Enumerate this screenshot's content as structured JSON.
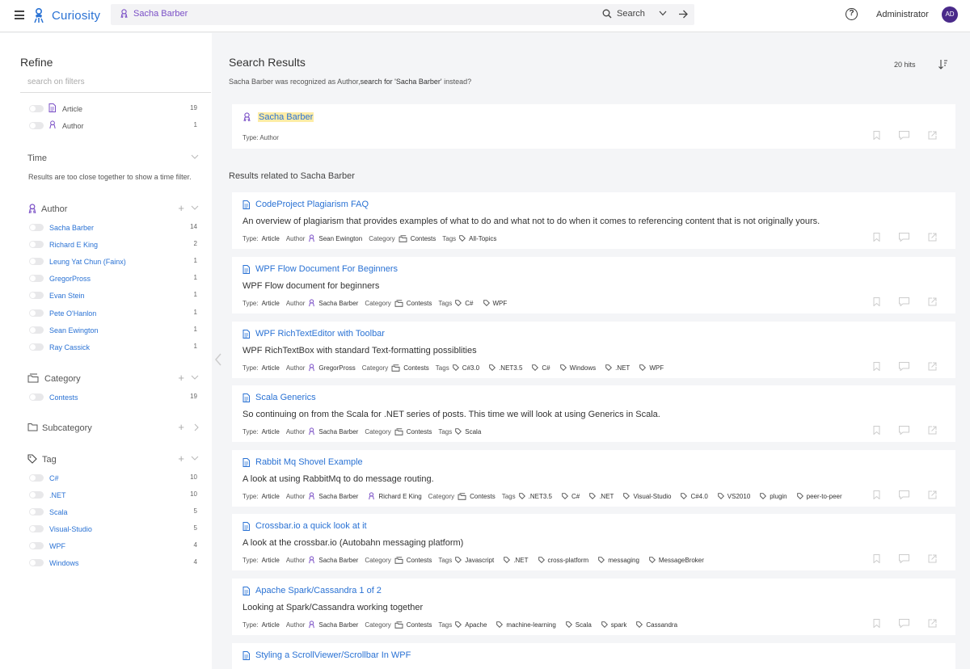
{
  "header": {
    "app_name": "Curiosity",
    "search_query": "Sacha Barber",
    "search_label": "Search",
    "help_symbol": "?",
    "user_name": "Administrator",
    "user_initials": "AD"
  },
  "sidebar": {
    "title": "Refine",
    "filter_placeholder": "search on filters",
    "types": [
      {
        "label": "Article",
        "count": "19",
        "icon": "document-icon"
      },
      {
        "label": "Author",
        "count": "1",
        "icon": "author-icon"
      }
    ],
    "time": {
      "title": "Time",
      "note": "Results are too close together to show a time filter."
    },
    "author": {
      "title": "Author",
      "items": [
        {
          "label": "Sacha Barber",
          "count": "14"
        },
        {
          "label": "Richard E King",
          "count": "2"
        },
        {
          "label": "Leung Yat Chun (Fainx)",
          "count": "1"
        },
        {
          "label": "GregorPross",
          "count": "1"
        },
        {
          "label": "Evan Stein",
          "count": "1"
        },
        {
          "label": "Pete O'Hanlon",
          "count": "1"
        },
        {
          "label": "Sean Ewington",
          "count": "1"
        },
        {
          "label": "Ray Cassick",
          "count": "1"
        }
      ]
    },
    "category": {
      "title": "Category",
      "items": [
        {
          "label": "Contests",
          "count": "19"
        }
      ]
    },
    "subcategory": {
      "title": "Subcategory"
    },
    "tag": {
      "title": "Tag",
      "items": [
        {
          "label": "C#",
          "count": "10"
        },
        {
          "label": ".NET",
          "count": "10"
        },
        {
          "label": "Scala",
          "count": "5"
        },
        {
          "label": "Visual-Studio",
          "count": "5"
        },
        {
          "label": "WPF",
          "count": "4"
        },
        {
          "label": "Windows",
          "count": "4"
        }
      ]
    }
  },
  "main": {
    "title": "Search Results",
    "hits": "20 hits",
    "recognized_prefix": "Sacha Barber was recognized as Author,",
    "recognized_link": "search for 'Sacha Barber'",
    "recognized_suffix": "instead?",
    "author_result": {
      "name": "Sacha Barber",
      "type_line": "Type: Author"
    },
    "related_title": "Results related to Sacha Barber",
    "labels": {
      "type": "Type:",
      "author": "Author",
      "category": "Category",
      "tags": "Tags"
    },
    "results": [
      {
        "title": "CodeProject Plagiarism FAQ",
        "description": "An overview of plagiarism that provides examples of what to do and what not to do when it comes to referencing content that is not originally yours.",
        "type": "Article",
        "authors": [
          "Sean Ewington"
        ],
        "category": "Contests",
        "tags": [
          "All-Topics"
        ]
      },
      {
        "title": "WPF Flow Document For Beginners",
        "description": "WPF Flow document for beginners",
        "type": "Article",
        "authors": [
          "Sacha Barber"
        ],
        "category": "Contests",
        "tags": [
          "C#",
          "WPF"
        ]
      },
      {
        "title": "WPF RichTextEditor with Toolbar",
        "description": "WPF RichTextBox with standard Text-formatting possiblities",
        "type": "Article",
        "authors": [
          "GregorPross"
        ],
        "category": "Contests",
        "tags": [
          "C#3.0",
          ".NET3.5",
          "C#",
          "Windows",
          ".NET",
          "WPF"
        ]
      },
      {
        "title": "Scala Generics",
        "description": "So continuing on from the Scala for .NET series of posts. This time we will look at using Generics in Scala.",
        "type": "Article",
        "authors": [
          "Sacha Barber"
        ],
        "category": "Contests",
        "tags": [
          "Scala"
        ]
      },
      {
        "title": "Rabbit Mq Shovel Example",
        "description": "A look at using RabbitMq to do message routing.",
        "type": "Article",
        "authors": [
          "Sacha Barber",
          "Richard E King"
        ],
        "category": "Contests",
        "tags": [
          ".NET3.5",
          "C#",
          ".NET",
          "Visual-Studio",
          "C#4.0",
          "VS2010",
          "plugin",
          "peer-to-peer"
        ]
      },
      {
        "title": "Crossbar.io a quick look at it",
        "description": "A look at the crossbar.io (Autobahn messaging platform)",
        "type": "Article",
        "authors": [
          "Sacha Barber"
        ],
        "category": "Contests",
        "tags": [
          "Javascript",
          ".NET",
          "cross-platform",
          "messaging",
          "MessageBroker"
        ]
      },
      {
        "title": "Apache Spark/Cassandra 1 of 2",
        "description": "Looking at Spark/Cassandra working together",
        "type": "Article",
        "authors": [
          "Sacha Barber"
        ],
        "category": "Contests",
        "tags": [
          "Apache",
          "machine-learning",
          "Scala",
          "spark",
          "Cassandra"
        ]
      },
      {
        "title": "Styling a ScrollViewer/Scrollbar In WPF",
        "description": "",
        "type": "Article",
        "authors": [],
        "category": "",
        "tags": []
      }
    ]
  },
  "colors": {
    "accent": "#2a72d4",
    "purple": "#7a4fc6",
    "avatar": "#4a2a8a",
    "highlight": "#fdeca6"
  }
}
